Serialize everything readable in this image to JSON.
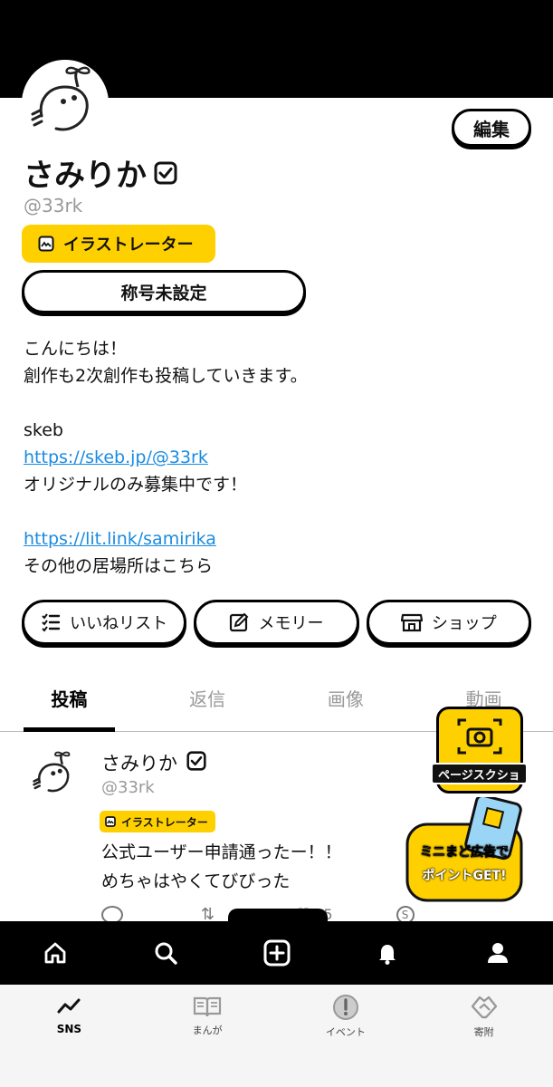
{
  "profile": {
    "display_name": "さみりか",
    "handle": "@33rk",
    "edit_label": "編集",
    "role_badge": "イラストレーター",
    "title_button": "称号未設定"
  },
  "bio": {
    "line1": "こんにちは！",
    "line2": "創作も2次創作も投稿していきます。",
    "line3": "skeb",
    "link1": "https://skeb.jp/@33rk",
    "line4": "オリジナルのみ募集中です！",
    "link2": "https://lit.link/samirika",
    "line5": "その他の居場所はこちら"
  },
  "actions": [
    {
      "label": "いいねリスト",
      "icon": "list-icon"
    },
    {
      "label": "メモリー",
      "icon": "edit-note-icon"
    },
    {
      "label": "ショップ",
      "icon": "shop-icon"
    }
  ],
  "tabs": [
    {
      "label": "投稿",
      "active": true
    },
    {
      "label": "返信",
      "active": false
    },
    {
      "label": "画像",
      "active": false
    },
    {
      "label": "動画",
      "active": false
    }
  ],
  "post": {
    "name": "さみりか",
    "handle": "@33rk",
    "badge": "イラストレーター",
    "text_line1": "公式ユーザー申請通ったー！！",
    "text_line2": "めちゃはやくてびびった",
    "like_count": "35"
  },
  "promos": {
    "screenshot_label": "ページスクショ",
    "ad_line1": "ミニまど広告で",
    "ad_line2": "ポイントGET!"
  },
  "navbar": [
    "home-icon",
    "search-icon",
    "create-post-icon",
    "bell-icon",
    "profile-icon"
  ],
  "bottom_tabs": [
    {
      "label": "SNS",
      "active": true
    },
    {
      "label": "まんが",
      "active": false
    },
    {
      "label": "イベント",
      "active": false
    },
    {
      "label": "寄附",
      "active": false
    }
  ],
  "colors": {
    "accent_yellow": "#ffd000",
    "link_blue": "#1a8be0",
    "text_muted": "#999999"
  }
}
